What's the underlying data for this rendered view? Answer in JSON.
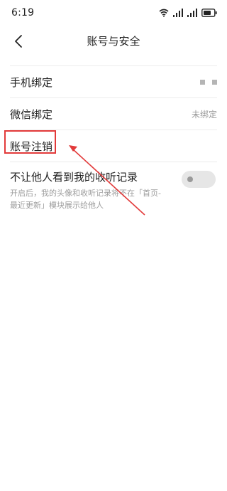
{
  "status_bar": {
    "time": "6:19",
    "icons": [
      "wifi-icon",
      "signal-icon",
      "signal-icon",
      "battery-icon"
    ]
  },
  "nav": {
    "title": "账号与安全",
    "back_icon": "back-chevron-icon"
  },
  "settings": {
    "phone_binding": {
      "label": "手机绑定",
      "value_masked": true
    },
    "wechat_binding": {
      "label": "微信绑定",
      "value": "未绑定"
    },
    "account_cancel": {
      "label": "账号注销"
    },
    "privacy": {
      "title": "不让他人看到我的收听记录",
      "description": "开启后，我的头像和收听记录将不在「首页-最近更新」模块展示给他人",
      "toggle_on": false
    }
  },
  "annotation": {
    "highlight_color": "#e23a3a"
  }
}
